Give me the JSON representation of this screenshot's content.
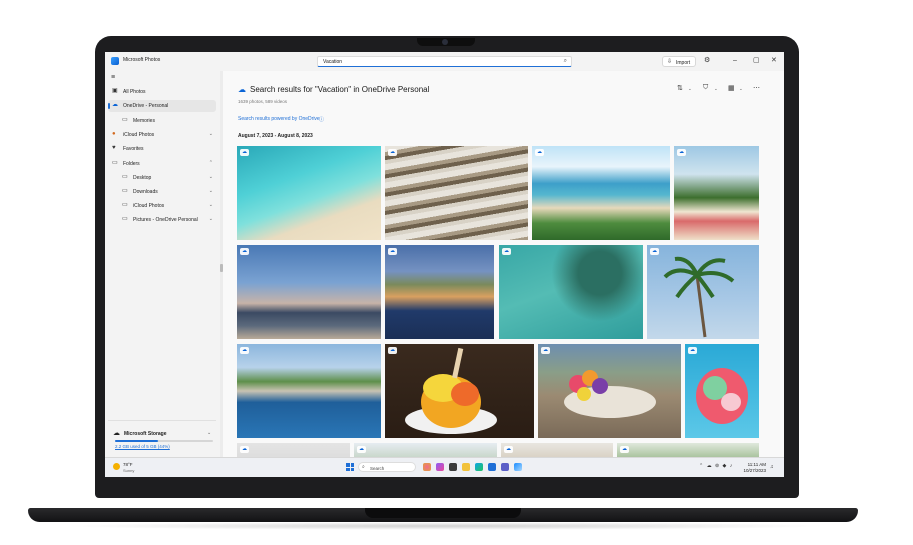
{
  "app": {
    "title": "Microsoft Photos",
    "search_value": "Vacation",
    "import_label": "Import"
  },
  "sidebar": {
    "items": [
      {
        "label": "All Photos",
        "icon": "photos-icon"
      },
      {
        "label": "OneDrive - Personal",
        "icon": "onedrive-cloud-icon",
        "active": true
      },
      {
        "label": "Memories",
        "icon": "memories-icon"
      },
      {
        "label": "iCloud Photos",
        "icon": "icloud-icon"
      },
      {
        "label": "Favorites",
        "icon": "heart-icon"
      },
      {
        "label": "Folders",
        "icon": "folder-icon"
      },
      {
        "label": "Desktop",
        "icon": "folder-icon"
      },
      {
        "label": "Downloads",
        "icon": "folder-icon"
      },
      {
        "label": "iCloud Photos",
        "icon": "folder-icon"
      },
      {
        "label": "Pictures - OneDrive Personal",
        "icon": "folder-icon"
      }
    ],
    "storage": {
      "title": "Microsoft Storage",
      "usage_text": "2.2 GB used of 5 GB (44%)",
      "used_fraction": 0.44
    }
  },
  "main": {
    "title": "Search results for \"Vacation\" in OneDrive Personal",
    "count": "1639 photos, 589 videos",
    "powered_by": "Search results powered by OneDrive",
    "date_range": "August 7, 2023 - August 8, 2023"
  },
  "taskbar": {
    "weather_temp": "78°F",
    "weather_condition": "Sunny",
    "search_label": "Search",
    "time": "11:11 AM",
    "date": "10/27/2023"
  },
  "colors": {
    "accent": "#1f6fd6",
    "onedrive": "#0a64d6"
  }
}
